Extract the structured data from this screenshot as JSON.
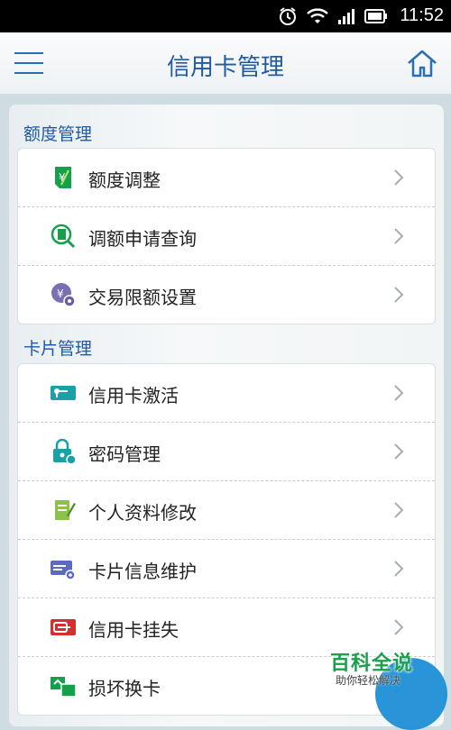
{
  "status_bar": {
    "time": "11:52"
  },
  "header": {
    "title": "信用卡管理"
  },
  "sections": [
    {
      "title": "额度管理",
      "items": [
        {
          "label": "额度调整",
          "icon": "quota-adjust-icon"
        },
        {
          "label": "调额申请查询",
          "icon": "quota-query-icon"
        },
        {
          "label": "交易限额设置",
          "icon": "limit-settings-icon"
        }
      ]
    },
    {
      "title": "卡片管理",
      "items": [
        {
          "label": "信用卡激活",
          "icon": "card-activate-icon"
        },
        {
          "label": "密码管理",
          "icon": "lock-icon"
        },
        {
          "label": "个人资料修改",
          "icon": "edit-profile-icon"
        },
        {
          "label": "卡片信息维护",
          "icon": "card-info-icon"
        },
        {
          "label": "信用卡挂失",
          "icon": "card-lost-icon"
        },
        {
          "label": "损坏换卡",
          "icon": "card-replace-icon"
        }
      ]
    }
  ],
  "watermark": {
    "title": "百科全说",
    "subtitle": "助你轻松解决"
  },
  "colors": {
    "accent": "#1f5aa6",
    "green": "#18a04a"
  }
}
